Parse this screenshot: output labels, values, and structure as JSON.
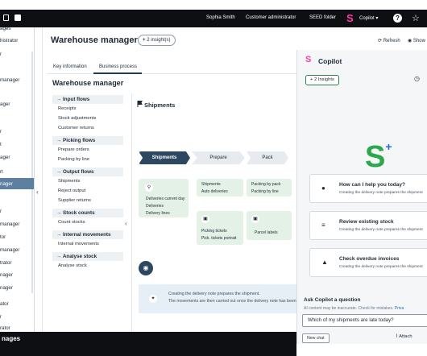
{
  "topbar": {
    "user": "Sophia Smith",
    "role": "Customer administrator",
    "folder": "SEED folder",
    "copilot_label": "Copilot",
    "help": "?"
  },
  "leftnav": {
    "items": [
      "ages",
      "histrator",
      "r",
      "manager",
      "ager",
      "r",
      "ager",
      "t",
      "rt",
      "nager",
      "r",
      "manager",
      "tor",
      "manager",
      "trator",
      "nager",
      "nager",
      "ator",
      "r",
      "rator"
    ],
    "bottom_label": "nages"
  },
  "header": {
    "title": "Warehouse manager",
    "insights": "2 insight(s)",
    "refresh": "Refresh",
    "show": "Show"
  },
  "tabs": [
    "Key information",
    "Business process"
  ],
  "section_title": "Warehouse manager",
  "process_groups": [
    {
      "label": "→ Input flows",
      "items": [
        "Receipts",
        "Stock adjustments",
        "Customer returns"
      ]
    },
    {
      "label": "→ Picking flows",
      "items": [
        "Prepare orders",
        "Packing by line"
      ]
    },
    {
      "label": "→ Output flows",
      "items": [
        "Shipments",
        "Reject output",
        "Supplier returns"
      ]
    },
    {
      "label": "→ Stock counts",
      "items": [
        "Count stocks"
      ]
    },
    {
      "label": "→ Internal movements",
      "items": [
        "Internal movements"
      ]
    },
    {
      "label": "→ Analyse stock",
      "items": [
        "Analyse stock"
      ]
    }
  ],
  "diagram": {
    "title": "Shipments",
    "stages": [
      "Shipments",
      "Prepare",
      "Pack"
    ],
    "card1": [
      "Deliveries current day",
      "Deliveries",
      "Delivery lines"
    ],
    "card2": [
      "Shipments",
      "Auto deliveries"
    ],
    "card3": [
      "Packing by pack",
      "Packing by line"
    ],
    "card4": [
      "Picking tickets",
      "Pick. tickets portrait"
    ],
    "card5": [
      "Parcel labels"
    ],
    "info_line1": "Creating the delivery note prepares the shipment.",
    "info_line2": "The movements are then carried out once the delivery note has been va"
  },
  "copilot": {
    "title": "Copilot",
    "insights": "2 Insights",
    "cards": [
      {
        "title": "How can I help you today?",
        "sub": "Creating the delivery note prepares the shipment"
      },
      {
        "title": "Review existing stock",
        "sub": "Creating the delivery note prepares the shipment"
      },
      {
        "title": "Check overdue invoices",
        "sub": "Creating the delivery note prepares the shipment"
      }
    ],
    "ask_title": "Ask Copilot a question",
    "disclaimer": "AI content may be inaccurate. Check for mistakes.",
    "disclaimer_link": "Priva",
    "input_value": "Which of my shipments are late today?",
    "new_chat": "New chat",
    "attach": "Attach"
  }
}
